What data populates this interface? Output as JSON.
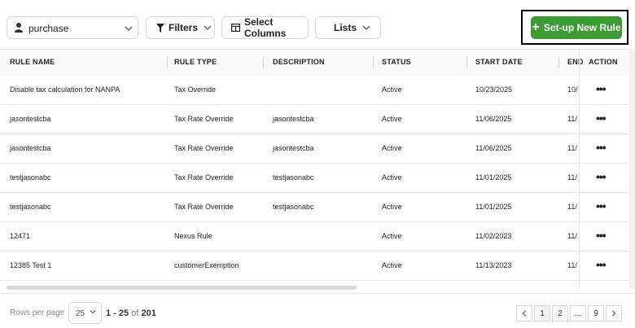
{
  "toolbar": {
    "selector_value": "purchase",
    "filters_label": "Filters",
    "select_columns_label": "Select Columns",
    "lists_label": "Lists",
    "new_rule_label": "Set-up New Rule"
  },
  "table": {
    "headers": [
      "RULE NAME",
      "RULE TYPE",
      "DESCRIPTION",
      "STATUS",
      "START DATE",
      "END",
      "ACTION"
    ],
    "rows": [
      [
        "Disable tax calculation for NANPA",
        "Tax Override",
        "",
        "Active",
        "10/23/2025",
        "10/"
      ],
      [
        "jasontestcba",
        "Tax Rate Override",
        "jasontestcba",
        "Active",
        "11/06/2025",
        "11/"
      ],
      [
        "jasontestcba",
        "Tax Rate Override",
        "jasontestcba",
        "Active",
        "11/06/2025",
        "11/"
      ],
      [
        "testjasonabc",
        "Tax Rate Override",
        "testjasonabc",
        "Active",
        "11/01/2025",
        "11/"
      ],
      [
        "testjasonabc",
        "Tax Rate Override",
        "testjasonabc",
        "Active",
        "11/01/2025",
        "11/"
      ],
      [
        "12471",
        "Nexus Rule",
        "",
        "Active",
        "11/02/2023",
        "11/"
      ],
      [
        "12385 Test 1",
        "customerExemption",
        "",
        "Active",
        "11/13/2023",
        "11/"
      ]
    ],
    "action_glyph": "•••"
  },
  "footer": {
    "rows_per_page_label": "Rows per page",
    "rows_per_page_value": "25",
    "range_text": "1 - 25",
    "of_text": "of",
    "total": "201",
    "pages": [
      "1",
      "2",
      "...",
      "9"
    ]
  },
  "colors": {
    "accent_green": "#3d9b35"
  }
}
